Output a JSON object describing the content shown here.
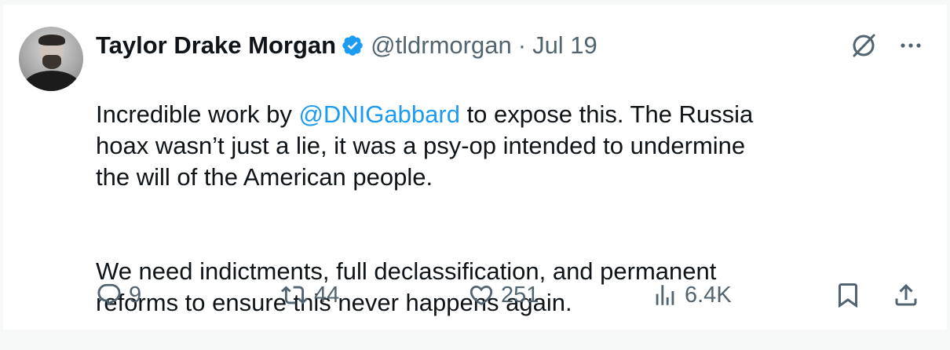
{
  "tweet": {
    "author_name": "Taylor Drake Morgan",
    "handle": "@tldrmorgan",
    "separator": "·",
    "date": "Jul 19",
    "body": {
      "para1_before": "Incredible work by ",
      "mention": "@DNIGabbard",
      "para1_after": " to expose this. The Russia\nhoax wasn’t just a lie, it was a psy-op intended to undermine\nthe will of the American people.",
      "para2": "We need indictments, full declassification, and permanent\nreforms to ensure this never happens again."
    },
    "stats": {
      "replies": "9",
      "reposts": "44",
      "likes": "251",
      "views": "6.4K"
    }
  },
  "icons": {
    "verified": "verified-badge-icon",
    "grok": "grok-icon",
    "more": "more-icon",
    "reply": "reply-icon",
    "repost": "repost-icon",
    "like": "heart-icon",
    "views": "views-icon",
    "bookmark": "bookmark-icon",
    "share": "share-icon"
  },
  "colors": {
    "text": "#0f1419",
    "secondary": "#536471",
    "accent": "#1d9bf0",
    "background": "#f7f9f9",
    "card": "#ffffff"
  }
}
